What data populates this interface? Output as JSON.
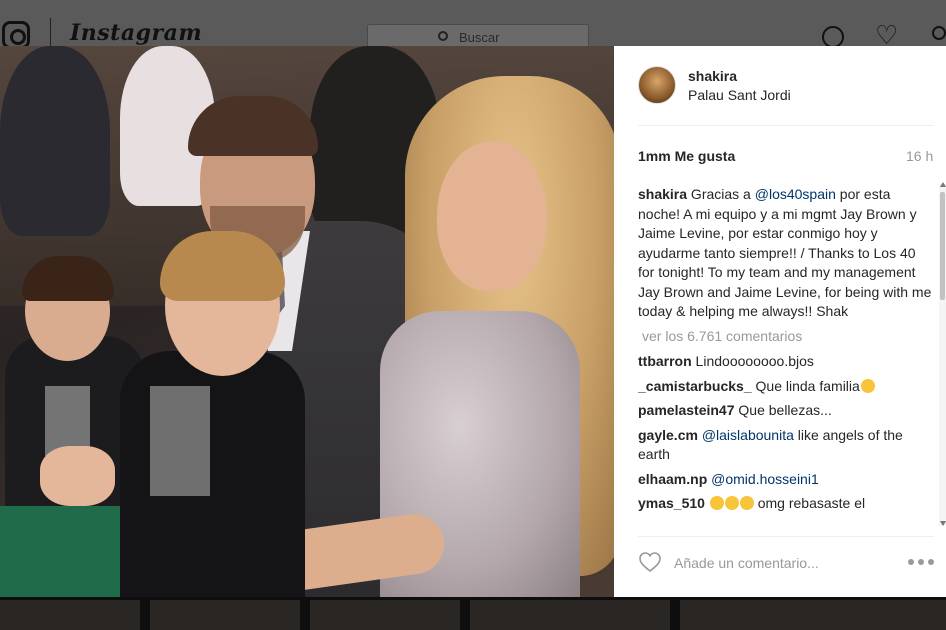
{
  "topbar": {
    "wordmark": "Instagram",
    "search_placeholder": "Buscar"
  },
  "post": {
    "username": "shakira",
    "location": "Palau Sant Jordi",
    "likes": "1mm Me gusta",
    "time": "16 h",
    "caption": {
      "user": "shakira",
      "before_mention": " Gracias a ",
      "mention": "@los40spain",
      "after_mention": " por esta noche! A mi equipo y a mi mgmt Jay Brown y Jaime Levine, por estar conmigo hoy y ayudarme tanto siempre!! / Thanks to Los 40 for tonight! To my team and my management Jay Brown and Jaime Levine, for being with me today & helping me always!! Shak"
    },
    "view_comments": "ver los 6.761 comentarios",
    "comments": [
      {
        "user": "ttbarron",
        "text": " Lindoooooooo.bjos"
      },
      {
        "user": "_camistarbucks_",
        "text": " Que linda familia"
      },
      {
        "user": "pamelastein47",
        "text": " Que bellezas..."
      },
      {
        "user": "gayle.cm",
        "mention": "@laislabounita",
        "text": " like angels of the earth"
      },
      {
        "user": "elhaam.np",
        "mention": "@omid.hosseini1",
        "text": ""
      },
      {
        "user": "ymas_510",
        "text": " omg rebasaste el"
      }
    ],
    "comment_placeholder": "Añade un comentario..."
  },
  "icons": {
    "top": [
      "instagram-logo-icon",
      "search-icon",
      "compass-icon",
      "heart-icon",
      "person-icon"
    ],
    "panel": [
      "heart-icon",
      "more-options-icon"
    ]
  },
  "colors": {
    "mention": "#003569",
    "text": "#262626",
    "muted": "#999999"
  }
}
